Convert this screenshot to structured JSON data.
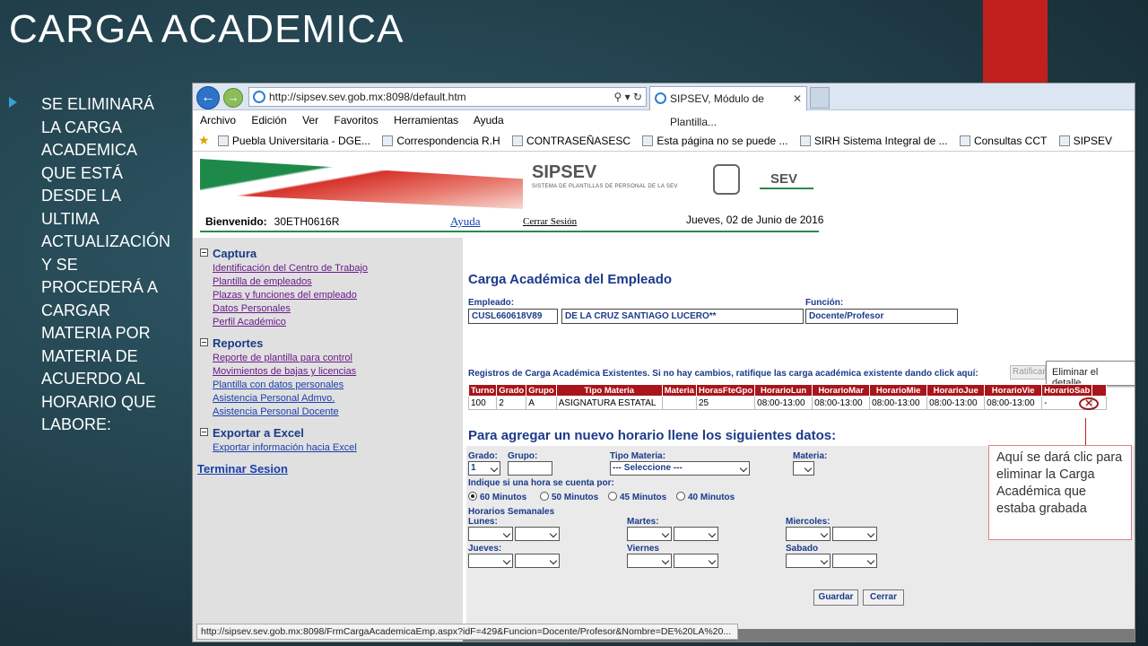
{
  "slide": {
    "title": "CARGA ACADEMICA",
    "bullet": "SE ELIMINARÁ LA CARGA ACADEMICA QUE ESTÁ DESDE LA ULTIMA ACTUALIZACIÓN Y SE PROCEDERÁ A CARGAR MATERIA POR MATERIA DE ACUERDO AL HORARIO QUE LABORE:",
    "callout": "Aquí se dará clic para eliminar la Carga Académica que estaba grabada",
    "accent_color": "#c1201c"
  },
  "browser": {
    "url": "http://sipsev.sev.gob.mx:8098/default.htm",
    "tab_title": "SIPSEV, Módulo de Plantilla...",
    "menu": [
      "Archivo",
      "Edición",
      "Ver",
      "Favoritos",
      "Herramientas",
      "Ayuda"
    ],
    "favorites": [
      "Puebla Universitaria - DGE...",
      "Correspondencia R.H",
      "CONTRASEÑASESC",
      "Esta página no se puede ...",
      "SIRH  Sistema Integral de ...",
      "Consultas CCT",
      "SIPSEV"
    ],
    "status_url": "http://sipsev.sev.gob.mx:8098/FrmCargaAcademicaEmp.aspx?idF=429&Funcion=Docente/Profesor&Nombre=DE%20LA%20..."
  },
  "header": {
    "logo": "SIPSEV",
    "logo_sub": "SISTEMA DE PLANTILLAS DE PERSONAL DE LA SEV",
    "sev": "SEV",
    "welcome_label": "Bienvenido:",
    "user": "30ETH0616R",
    "help": "Ayuda",
    "logout": "Cerrar Sesión",
    "date": "Jueves, 02 de Junio de 2016"
  },
  "sidebar": {
    "captura": {
      "title": "Captura",
      "items": [
        "Identificación del Centro de Trabajo",
        "Plantilla de empleados",
        "Plazas y funciones del empleado",
        "Datos Personales",
        "Perfil Académico"
      ]
    },
    "reportes": {
      "title": "Reportes",
      "items": [
        "Reporte de plantilla para control",
        "Movimientos de bajas y licencias",
        "Plantilla con datos personales",
        "Asistencia Personal Admvo.",
        "Asistencia Personal Docente"
      ]
    },
    "exportar": {
      "title": "Exportar a Excel",
      "items": [
        "Exportar información hacia Excel"
      ]
    },
    "terminar": "Terminar Sesion"
  },
  "main": {
    "title": "Carga Académica del Empleado",
    "empleado_label": "Empleado:",
    "empleado_rfc": "CUSL660618V89",
    "empleado_nombre": "DE LA CRUZ SANTIAGO LUCERO**",
    "funcion_label": "Función:",
    "funcion": "Docente/Profesor",
    "registros_text": "Registros de Carga Académica Existentes. Si no hay cambios, ratifique las carga académica existente dando click aquí:",
    "ratificar": "Ratificar",
    "tooltip": "Eliminar el detalle",
    "table": {
      "headers": [
        "Turno",
        "Grado",
        "Grupo",
        "Tipo Materia",
        "Materia",
        "HorasFteGpo",
        "HorarioLun",
        "HorarioMar",
        "HorarioMie",
        "HorarioJue",
        "HorarioVie",
        "HorarioSab",
        ""
      ],
      "rows": [
        [
          "100",
          "2",
          "A",
          "ASIGNATURA ESTATAL",
          "",
          "25",
          "08:00-13:00",
          "08:00-13:00",
          "08:00-13:00",
          "08:00-13:00",
          "08:00-13:00",
          "-",
          ""
        ]
      ]
    },
    "form_title": "Para agregar un nuevo horario llene los siguientes datos:",
    "grado_label": "Grado:",
    "grado_value": "1",
    "grupo_label": "Grupo:",
    "tipo_label": "Tipo Materia:",
    "tipo_value": "--- Seleccione ---",
    "materia_label": "Materia:",
    "hora_label": "Indique si una hora se cuenta por:",
    "radios": [
      "60 Minutos",
      "50 Minutos",
      "45 Minutos",
      "40 Minutos"
    ],
    "horarios_label": "Horarios Semanales",
    "days": [
      "Lunes:",
      "Martes:",
      "Miercoles:",
      "Jueves:",
      "Viernes",
      "Sabado"
    ],
    "guardar": "Guardar",
    "cerrar": "Cerrar"
  }
}
